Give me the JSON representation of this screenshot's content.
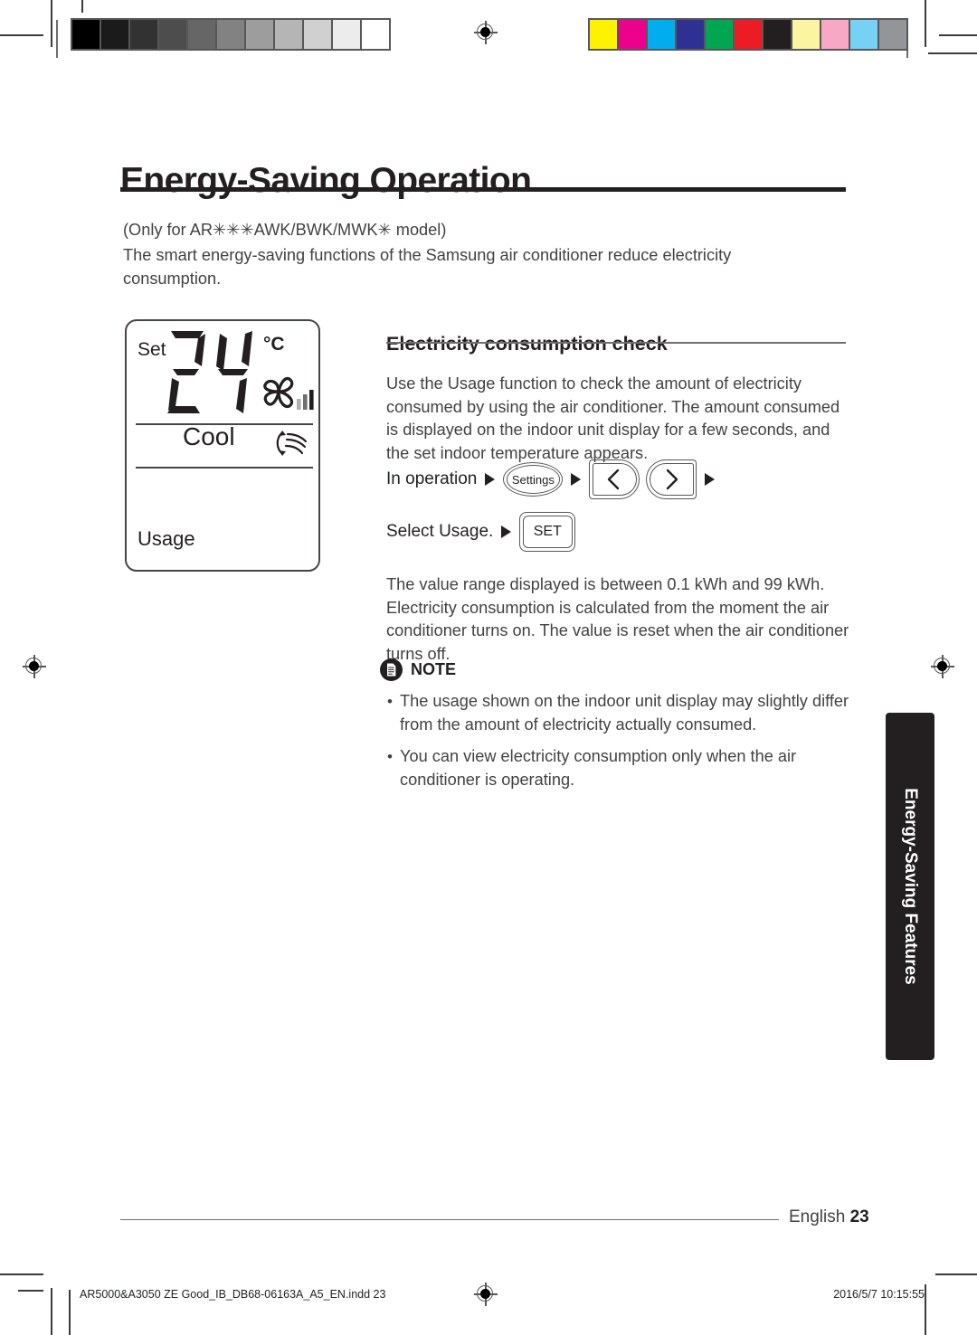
{
  "document": {
    "title": "Energy-Saving Operation",
    "model_note": "(Only for AR✳✳✳AWK/BWK/MWK✳ model)",
    "intro": "The smart energy-saving functions of the Samsung air conditioner reduce electricity consumption.",
    "page_number_label": "English",
    "page_number": "23",
    "side_tab_label": "Energy-Saving Features"
  },
  "lcd": {
    "set_label": "Set",
    "temperature": "24",
    "degree_unit": "°C",
    "mode": "Cool",
    "usage_label": "Usage",
    "fan_bars": 3,
    "fan_icon": "pinwheel-fan-icon",
    "swing_icon": "air-swing-icon"
  },
  "section": {
    "heading": "Electricity consumption check",
    "paragraph_1": "Use the Usage function to check the amount of electricity consumed by using the air conditioner. The amount consumed is displayed on the indoor unit display for a few seconds, and the set indoor temperature appears.",
    "paragraph_2": "The value range displayed is between 0.1 kWh and 99 kWh. Electricity consumption is calculated from the moment the air conditioner turns on. The value is reset when the air conditioner turns off."
  },
  "flow": {
    "row1_label": "In operation",
    "settings_button": "Settings",
    "prev_button": "chevron-left-icon",
    "next_button": "chevron-right-icon",
    "row2_label": "Select Usage.",
    "set_button": "SET"
  },
  "note": {
    "icon": "note-document-icon",
    "title": "NOTE",
    "bullet": "•",
    "items": [
      "The usage shown on the indoor unit display may slightly differ from the amount of electricity actually consumed.",
      "You can view electricity consumption only when the air conditioner is operating."
    ]
  },
  "print_marks": {
    "filename": "AR5000&A3050 ZE Good_IB_DB68-06163A_A5_EN.indd   23",
    "timestamp": "2016/5/7   10:15:55",
    "gray_wedge": [
      "#000000",
      "#1b1b1b",
      "#323232",
      "#4d4d4d",
      "#666666",
      "#828282",
      "#9d9d9d",
      "#b5b5b5",
      "#d0d0d0",
      "#ececec",
      "#ffffff"
    ],
    "color_bar": [
      "#fff200",
      "#ec008c",
      "#00aeef",
      "#2e3192",
      "#00a651",
      "#ed1c24",
      "#231f20",
      "#fbf4a0",
      "#f7a8c4",
      "#76d2f5",
      "#939598"
    ]
  }
}
